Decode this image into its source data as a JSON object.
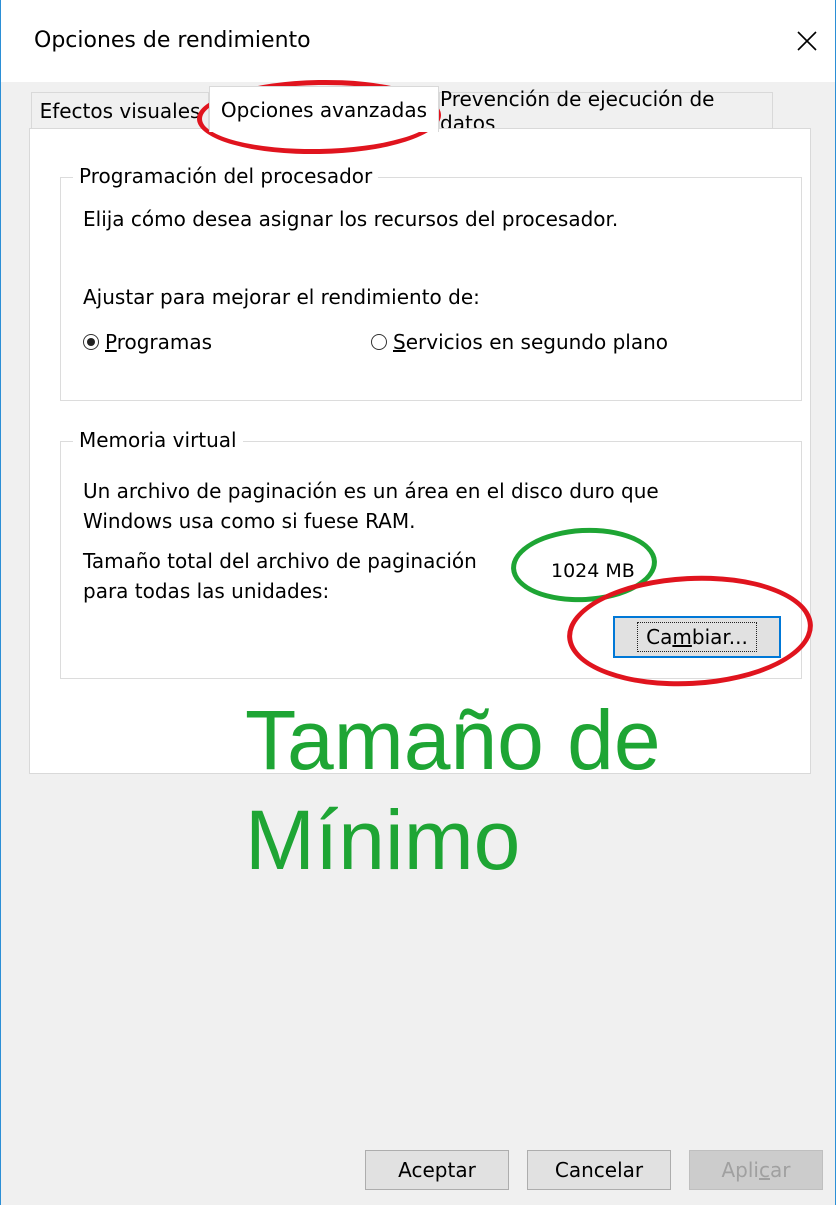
{
  "window": {
    "title": "Opciones de rendimiento"
  },
  "tabs": [
    {
      "label": "Efectos visuales"
    },
    {
      "label": "Opciones avanzadas"
    },
    {
      "label": "Prevención de ejecución de datos"
    }
  ],
  "processor": {
    "legend": "Programación del procesador",
    "description": "Elija cómo desea asignar los recursos del procesador.",
    "adjust_label": "Ajustar para mejorar el rendimiento de:",
    "option_programs": {
      "mnemonic": "P",
      "rest": "rogramas",
      "selected": true
    },
    "option_services": {
      "mnemonic": "S",
      "rest": "ervicios en segundo plano",
      "selected": false
    }
  },
  "virtual_memory": {
    "legend": "Memoria virtual",
    "description_line1": "Un archivo de paginación es un área en el disco duro que",
    "description_line2": "Windows usa como si fuese RAM.",
    "size_label_line1": "Tamaño total del archivo de paginación",
    "size_label_line2": "para todas las unidades:",
    "size_value": "1024 MB",
    "change_button": {
      "pre": "Ca",
      "mnemonic": "m",
      "post": "biar..."
    }
  },
  "annotation": {
    "line1": "Tamaño de",
    "line2": "Mínimo",
    "color": "#1ea534"
  },
  "highlight_colors": {
    "red": "#e0141e",
    "green": "#1ea534"
  },
  "buttons": {
    "accept": "Aceptar",
    "cancel": "Cancelar",
    "apply": {
      "pre": "Apli",
      "mnemonic": "c",
      "post": "ar",
      "enabled": false
    }
  }
}
